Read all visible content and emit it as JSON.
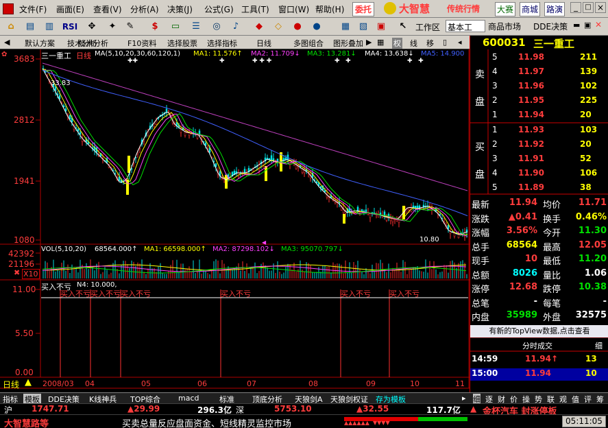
{
  "menu": [
    "文件(F)",
    "画面(E)",
    "查看(V)",
    "分析(A)",
    "决策(J)",
    "公式(G)",
    "工具(T)",
    "窗口(W)",
    "帮助(H)"
  ],
  "menu_right": {
    "weituo": "委托",
    "brand": "大智慧",
    "brand_sub": "传统行情",
    "dasai": "大赛",
    "shangcheng": "商城",
    "luyan": "路演"
  },
  "toolbar": {
    "rsi": "RSI",
    "workspace": "工作区",
    "workspace_select": "基本工",
    "goods": "商品市场",
    "dde": "DDE决策"
  },
  "funcbar": [
    "默认方案",
    "技术分析",
    "F10资料",
    "选择股票",
    "选择指标",
    "日线",
    "多图组合",
    "图形叠加"
  ],
  "funcbar_right": [
    "权",
    "线",
    "移"
  ],
  "stock": {
    "code": "600031",
    "name": "三一重工"
  },
  "chart_header": {
    "name": "三一重工",
    "period": "日线",
    "ma_params": "MA(5,10,20,30,60,120,1)",
    "ma1": "MA1: 11.576↑",
    "ma2": "MA2: 11.709↓",
    "ma3": "MA3: 13.281↓",
    "ma4": "MA4: 13.638↓",
    "ma5": "MA5: 14.900"
  },
  "y_labels": {
    "top": "3683",
    "mid1": "2812",
    "mid2": "1941",
    "bottom": "1080"
  },
  "price_marks": {
    "high": "33.83",
    "low": "10.80"
  },
  "vol_header": {
    "params": "VOL(5,10,20)",
    "v": "68564.000↑",
    "ma1": "MA1: 66598.000↑",
    "ma2": "MA2: 87298.102↓",
    "ma3": "MA3: 95070.797↓"
  },
  "vol_labels": {
    "top": "42392",
    "mid": "21196",
    "unit": "X10"
  },
  "ind_header": {
    "name": "买入不亏",
    "n4": "N4: 10.000,"
  },
  "ind_labels": {
    "top": "11.00",
    "mid": "5.50",
    "bottom": "0.00"
  },
  "ind_signal": "买入不亏",
  "x_labels": [
    "2008/03",
    "04",
    "05",
    "06",
    "07",
    "08",
    "09",
    "10",
    "11"
  ],
  "period_label": "日线",
  "orderbook": {
    "sell_label1": "卖",
    "sell_label2": "盘",
    "buy_label1": "买",
    "buy_label2": "盘",
    "sell": [
      [
        "5",
        "11.98",
        "211"
      ],
      [
        "4",
        "11.97",
        "139"
      ],
      [
        "3",
        "11.96",
        "102"
      ],
      [
        "2",
        "11.95",
        "225"
      ],
      [
        "1",
        "11.94",
        "20"
      ]
    ],
    "buy": [
      [
        "1",
        "11.93",
        "103"
      ],
      [
        "2",
        "11.92",
        "20"
      ],
      [
        "3",
        "11.91",
        "52"
      ],
      [
        "4",
        "11.90",
        "106"
      ],
      [
        "5",
        "11.89",
        "38"
      ]
    ]
  },
  "quote": [
    [
      "最新",
      "11.94",
      "均价",
      "11.71"
    ],
    [
      "涨跌",
      "▲0.41",
      "换手",
      "0.46%"
    ],
    [
      "涨幅",
      "3.56%",
      "今开",
      "11.30"
    ],
    [
      "总手",
      "68564",
      "最高",
      "12.05"
    ],
    [
      "现手",
      "10",
      "最低",
      "11.20"
    ],
    [
      "总额",
      "8026",
      "量比",
      "1.06"
    ],
    [
      "涨停",
      "12.68",
      "跌停",
      "10.38"
    ],
    [
      "总笔",
      "-",
      "每笔",
      "-"
    ],
    [
      "内盘",
      "35989",
      "外盘",
      "32575"
    ]
  ],
  "topview": "有新的TopView数据,点击查看",
  "ticks_header": {
    "title": "分时成交",
    "fine": "细"
  },
  "ticks": [
    [
      "14:59",
      "11.94↑",
      "13"
    ],
    [
      "15:00",
      "11.94",
      "10"
    ]
  ],
  "bottom_tabs": [
    "指标",
    "模板",
    "DDE决策",
    "K线神兵",
    "TOP综合",
    "macd",
    "标准",
    "顶底分析",
    "天狼剑A",
    "天狼剑权证",
    "存为模板"
  ],
  "right_tabs": [
    "细",
    "逐",
    "财",
    "价",
    "操",
    "势",
    "联",
    "观",
    "值",
    "评",
    "筹"
  ],
  "status1": {
    "sh": "沪",
    "sh_idx": "1747.71",
    "sh_chg": "▲29.99",
    "sh_amt": "296.3亿",
    "sz": "深",
    "sz_idx": "5753.10",
    "sz_chg": "▲32.55",
    "sz_amt": "117.7亿",
    "alert": "金杯汽车 封涨停板"
  },
  "status2": {
    "brand": "大智慧路等",
    "ticker": "买卖总量反应盘面资金、短线精灵监控市场",
    "time": "05:11:05"
  }
}
